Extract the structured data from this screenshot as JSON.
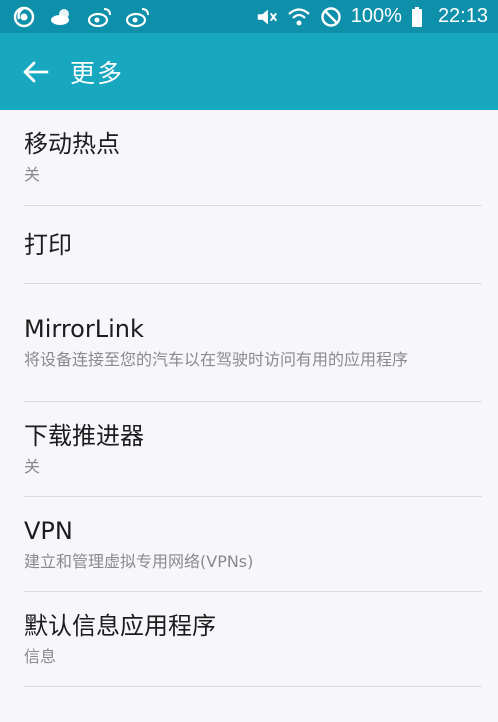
{
  "status_bar": {
    "icons_left": [
      "notification-icon",
      "weather-icon",
      "weibo-icon",
      "weibo-icon"
    ],
    "icons_right": [
      "mute-icon",
      "wifi-icon",
      "do-not-disturb-icon",
      "battery-icon"
    ],
    "battery": "100%",
    "time": "22:13"
  },
  "app_bar": {
    "title": "更多",
    "color": "#17a7be"
  },
  "items": [
    {
      "title": "移动热点",
      "subtitle": "关"
    },
    {
      "title": "打印",
      "subtitle": ""
    },
    {
      "title": "MirrorLink",
      "subtitle": "将设备连接至您的汽车以在驾驶时访问有用的应用程序"
    },
    {
      "title": "下载推进器",
      "subtitle": "关"
    },
    {
      "title": "VPN",
      "subtitle": "建立和管理虚拟专用网络(VPNs)"
    },
    {
      "title": "默认信息应用程序",
      "subtitle": "信息"
    }
  ]
}
